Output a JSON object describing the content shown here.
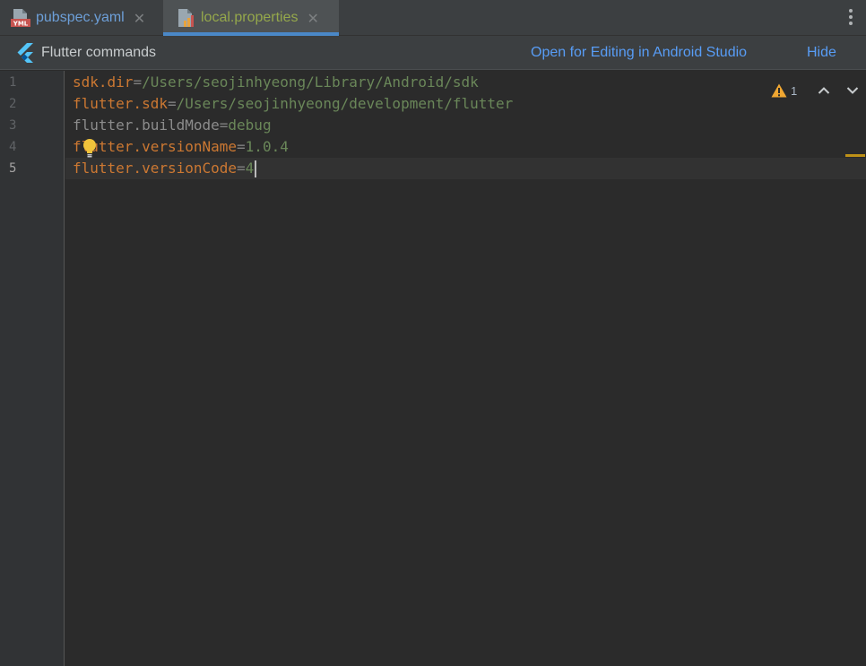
{
  "tabs": [
    {
      "label": "pubspec.yaml",
      "icon": "yaml-file-icon",
      "active": false
    },
    {
      "label": "local.properties",
      "icon": "properties-file-icon",
      "active": true
    }
  ],
  "notification": {
    "title": "Flutter commands",
    "open_link": "Open for Editing in Android Studio",
    "hide_link": "Hide"
  },
  "inspection": {
    "warning_count": "1",
    "colors": {
      "warning": "#f0a732"
    }
  },
  "editor": {
    "current_line": 5,
    "lines": [
      {
        "number": "1",
        "key": "sdk.dir",
        "sep": "=",
        "value": "/Users/seojinhyeong/Library/Android/sdk"
      },
      {
        "number": "2",
        "key": "flutter.sdk",
        "sep": "=",
        "value": "/Users/seojinhyeong/development/flutter"
      },
      {
        "number": "3",
        "key": "flutter.buildMode",
        "sep": "=",
        "value": "debug"
      },
      {
        "number": "4",
        "key": "flutter.versionName",
        "sep": "=",
        "value": "1.0.4"
      },
      {
        "number": "5",
        "key": "flutter.versionCode",
        "sep": "=",
        "value": "4"
      }
    ]
  },
  "theme": {
    "key_color": "#cc7832",
    "value_color": "#6a8759",
    "link_color": "#589df6",
    "tab_accent": "#4a88c7"
  }
}
